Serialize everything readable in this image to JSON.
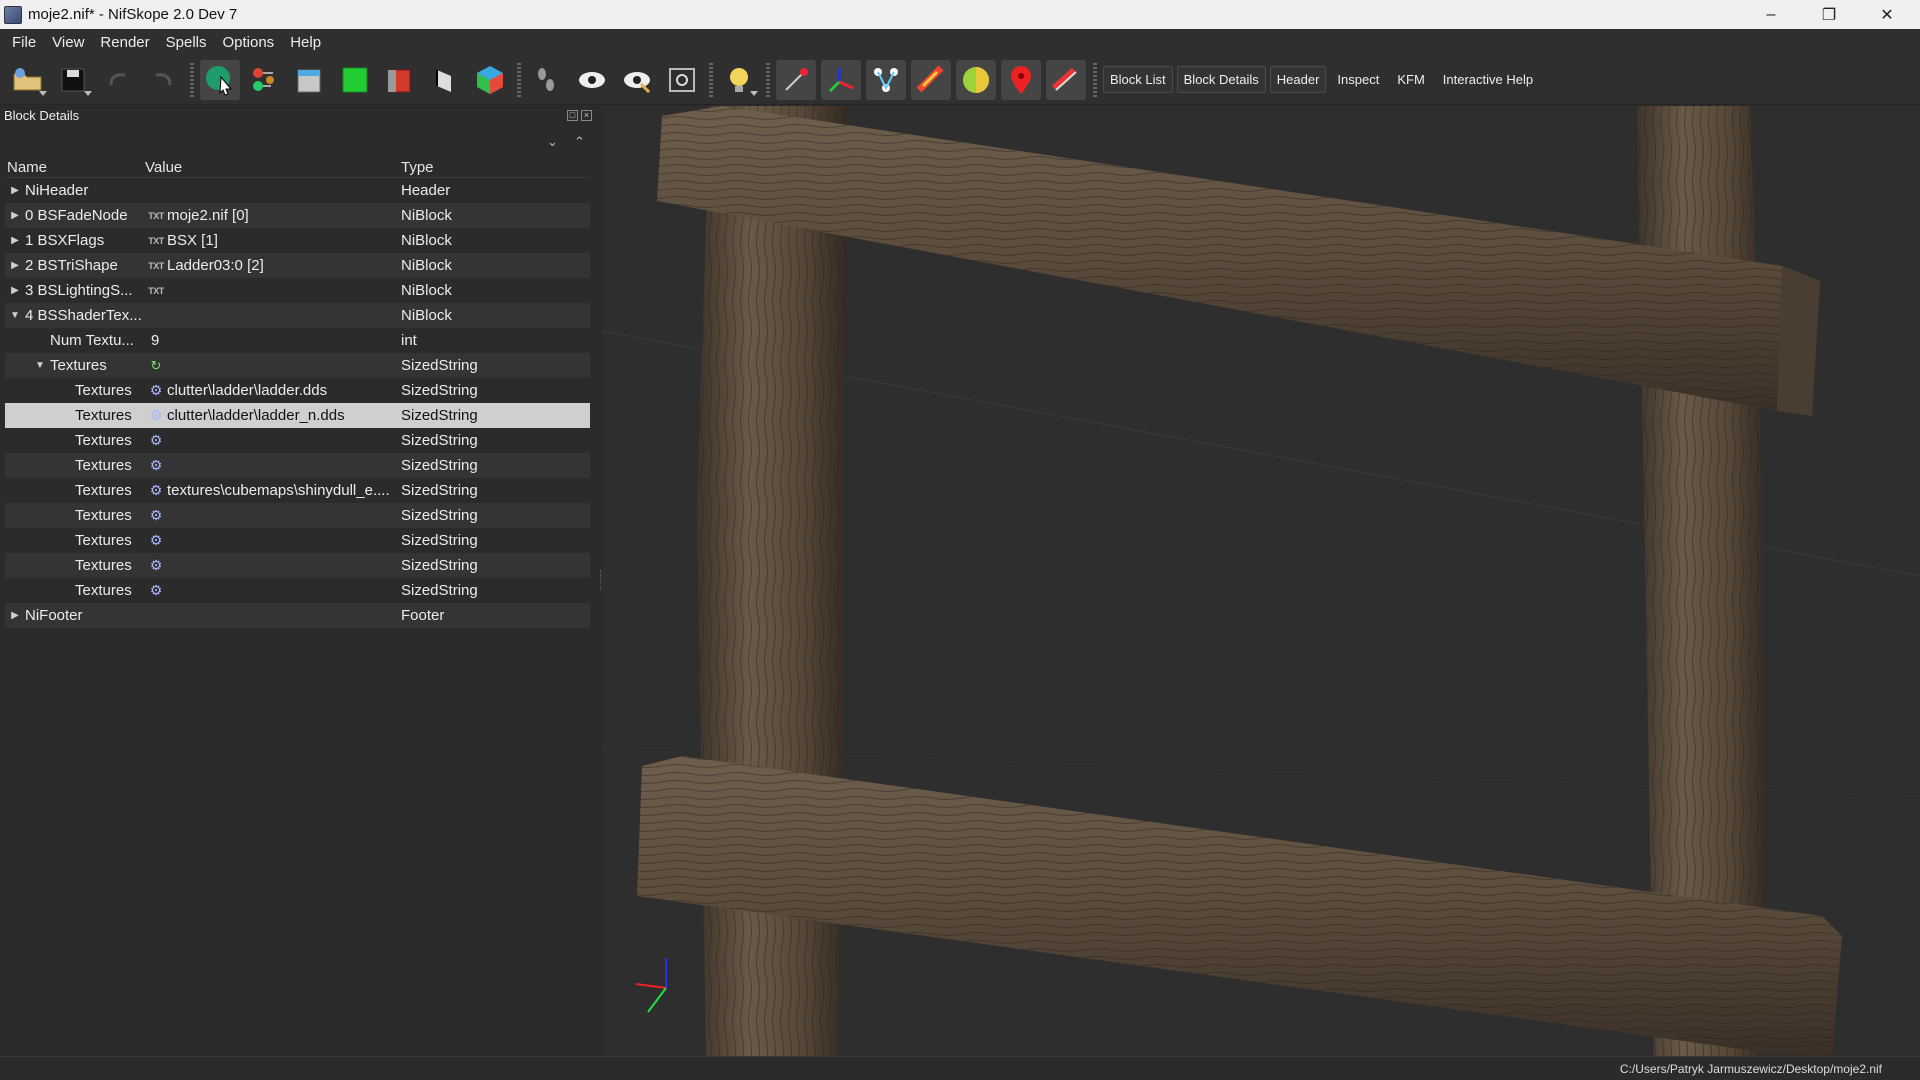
{
  "window": {
    "title": "moje2.nif* - NifSkope 2.0 Dev 7"
  },
  "menu": [
    "File",
    "View",
    "Render",
    "Spells",
    "Options",
    "Help"
  ],
  "toolbar": {
    "icons": [
      "open-icon",
      "save-icon",
      "undo-icon",
      "redo-icon",
      "select-icon",
      "connect-icon",
      "view-front-icon",
      "view-top-icon",
      "view-side-icon",
      "view-flip-icon",
      "view-perspective-icon",
      "walk-icon",
      "visibility-icon",
      "visibility-alt-icon",
      "screenshot-icon",
      "light-icon",
      "vertex-icon",
      "axes-icon",
      "nodes-icon",
      "collision-icon",
      "shading-icon",
      "marker-icon",
      "paint-icon"
    ],
    "text_buttons": [
      "Block List",
      "Block Details",
      "Header",
      "Inspect",
      "KFM",
      "Interactive Help"
    ]
  },
  "panel": {
    "title": "Block Details",
    "columns": {
      "name": "Name",
      "value": "Value",
      "type": "Type"
    }
  },
  "tree": [
    {
      "name": "NiHeader",
      "value": "",
      "type": "Header",
      "level": 0,
      "exp": "right",
      "icon": ""
    },
    {
      "name": "0 BSFadeNode",
      "value": "moje2.nif [0]",
      "type": "NiBlock",
      "level": 0,
      "exp": "right",
      "icon": "txt"
    },
    {
      "name": "1 BSXFlags",
      "value": "BSX [1]",
      "type": "NiBlock",
      "level": 0,
      "exp": "right",
      "icon": "txt"
    },
    {
      "name": "2 BSTriShape",
      "value": "Ladder03:0 [2]",
      "type": "NiBlock",
      "level": 0,
      "exp": "right",
      "icon": "txt"
    },
    {
      "name": "3 BSLightingS...",
      "value": "",
      "type": "NiBlock",
      "level": 0,
      "exp": "right",
      "icon": "txt"
    },
    {
      "name": "4 BSShaderTex...",
      "value": "",
      "type": "NiBlock",
      "level": 0,
      "exp": "down",
      "icon": ""
    },
    {
      "name": "Num Textu...",
      "value": "9",
      "type": "int",
      "level": 1,
      "exp": "",
      "icon": ""
    },
    {
      "name": "Textures",
      "value": "",
      "type": "SizedString",
      "level": 1,
      "exp": "down",
      "icon": "refresh"
    },
    {
      "name": "Textures",
      "value": "clutter\\ladder\\ladder.dds",
      "type": "SizedString",
      "level": 2,
      "exp": "",
      "icon": "gear"
    },
    {
      "name": "Textures",
      "value": "clutter\\ladder\\ladder_n.dds",
      "type": "SizedString",
      "level": 2,
      "exp": "",
      "icon": "gear",
      "selected": true
    },
    {
      "name": "Textures",
      "value": "",
      "type": "SizedString",
      "level": 2,
      "exp": "",
      "icon": "gear"
    },
    {
      "name": "Textures",
      "value": "",
      "type": "SizedString",
      "level": 2,
      "exp": "",
      "icon": "gear"
    },
    {
      "name": "Textures",
      "value": "textures\\cubemaps\\shinydull_e....",
      "type": "SizedString",
      "level": 2,
      "exp": "",
      "icon": "gear"
    },
    {
      "name": "Textures",
      "value": "",
      "type": "SizedString",
      "level": 2,
      "exp": "",
      "icon": "gear"
    },
    {
      "name": "Textures",
      "value": "",
      "type": "SizedString",
      "level": 2,
      "exp": "",
      "icon": "gear"
    },
    {
      "name": "Textures",
      "value": "",
      "type": "SizedString",
      "level": 2,
      "exp": "",
      "icon": "gear"
    },
    {
      "name": "Textures",
      "value": "",
      "type": "SizedString",
      "level": 2,
      "exp": "",
      "icon": "gear"
    },
    {
      "name": "NiFooter",
      "value": "",
      "type": "Footer",
      "level": 0,
      "exp": "right",
      "icon": ""
    }
  ],
  "status": {
    "path": "C:/Users/Patryk Jarmuszewicz/Desktop/moje2.nif"
  },
  "colors": {
    "wood": "#5a4a3a",
    "wood_dark": "#3b3128",
    "viewport_bg": "#2e2e2e",
    "selection": "#cfcfcf"
  }
}
